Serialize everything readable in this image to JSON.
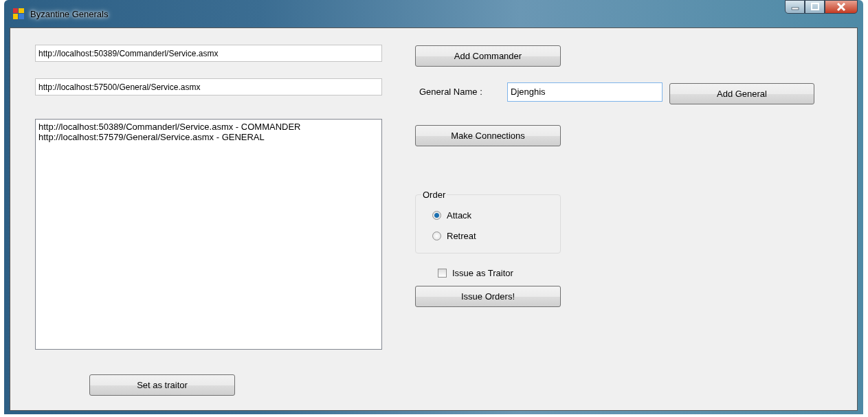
{
  "window": {
    "title": "Byzantine Generals"
  },
  "commander_url": {
    "value": "http://localhost:50389/Commanderl/Service.asmx"
  },
  "general_url": {
    "value": "http://localhost:57500/General/Service.asmx"
  },
  "connections": [
    {
      "label": "http://localhost:50389/Commanderl/Service.asmx - COMMANDER"
    },
    {
      "label": "http://localhost:57579/General/Service.asmx - GENERAL"
    }
  ],
  "set_traitor_button": "Set as traitor",
  "add_commander_button": "Add Commander",
  "general_name": {
    "label": "General Name :",
    "value": "Djenghis"
  },
  "add_general_button": "Add General",
  "make_connections_button": "Make Connections",
  "order": {
    "title": "Order",
    "options": [
      {
        "label": "Attack",
        "selected": true
      },
      {
        "label": "Retreat",
        "selected": false
      }
    ]
  },
  "issue_as_traitor": {
    "label": "Issue as Traitor",
    "checked": false
  },
  "issue_orders_button": "Issue Orders!"
}
